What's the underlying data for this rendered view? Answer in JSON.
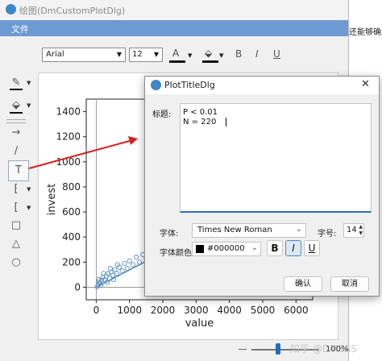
{
  "main_window": {
    "title": "绘图(DmCustomPlotDlg)",
    "menu": [
      "文件"
    ],
    "font_name": "Arial",
    "font_size": "12",
    "zoom": "100%"
  },
  "page_side_text": "还能够确立",
  "plot": {
    "chart_data": {
      "type": "scatter",
      "xlabel": "value",
      "ylabel": "invest",
      "x_ticks": [
        "0",
        "1000",
        "2000",
        "3000",
        "4000",
        "5000",
        "6000"
      ],
      "y_ticks": [
        "0",
        "200",
        "400",
        "600",
        "800",
        "1000",
        "1200",
        "1400"
      ],
      "xlim": [
        -300,
        6500
      ],
      "ylim": [
        -100,
        1500
      ],
      "points": [
        [
          30,
          5
        ],
        [
          60,
          20
        ],
        [
          90,
          40
        ],
        [
          120,
          30
        ],
        [
          160,
          55
        ],
        [
          200,
          80
        ],
        [
          250,
          60
        ],
        [
          300,
          90
        ],
        [
          350,
          110
        ],
        [
          400,
          70
        ],
        [
          450,
          120
        ],
        [
          500,
          95
        ],
        [
          560,
          140
        ],
        [
          620,
          110
        ],
        [
          700,
          160
        ],
        [
          780,
          130
        ],
        [
          850,
          190
        ],
        [
          930,
          150
        ],
        [
          1000,
          210
        ],
        [
          1100,
          180
        ],
        [
          1200,
          240
        ],
        [
          1300,
          200
        ],
        [
          1400,
          260
        ],
        [
          1500,
          230
        ],
        [
          1650,
          280
        ],
        [
          80,
          60
        ],
        [
          140,
          15
        ],
        [
          220,
          110
        ],
        [
          330,
          40
        ],
        [
          420,
          150
        ],
        [
          520,
          60
        ],
        [
          640,
          180
        ]
      ],
      "fit_line": [
        [
          0,
          0
        ],
        [
          1700,
          235
        ]
      ],
      "series_color": "#5b8fc4"
    }
  },
  "dialog": {
    "title": "PlotTitleDlg",
    "title_label": "标题:",
    "title_text_lines": [
      "P < 0.01",
      "N = 220"
    ],
    "font_label": "字体:",
    "font_value": "Times New Roman",
    "size_label": "字号:",
    "size_value": "14",
    "color_label": "字体颜色:",
    "color_value": "#000000",
    "bold": "B",
    "italic": "I",
    "underline": "U",
    "ok": "确认",
    "cancel": "取消"
  },
  "watermark": "知乎 @DMSAS",
  "icons": {
    "app": "app-icon",
    "close": "close-icon"
  }
}
